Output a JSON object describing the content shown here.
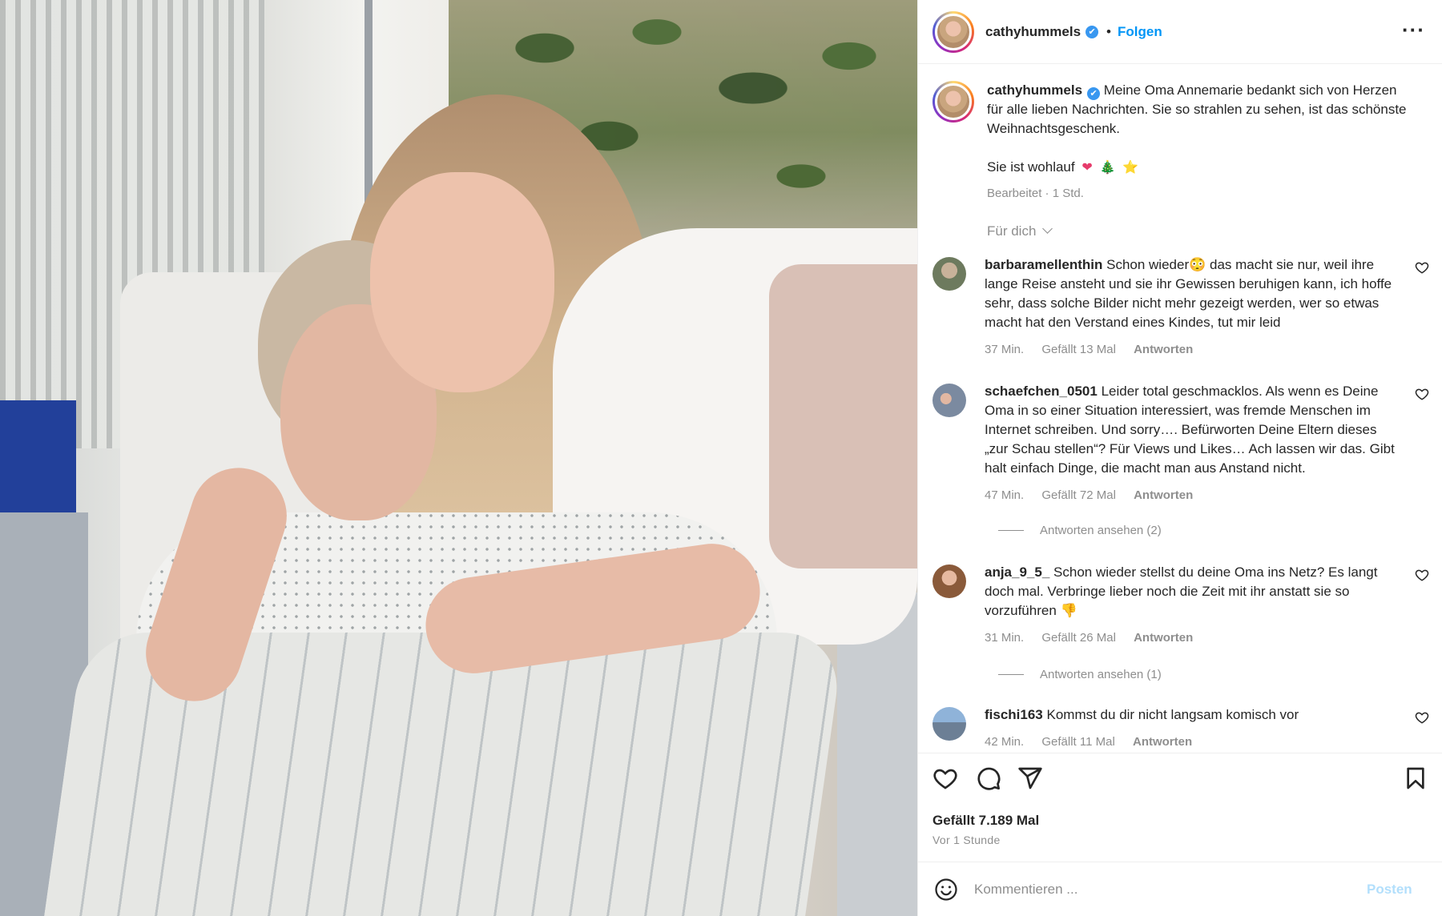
{
  "post": {
    "username": "cathyhummels",
    "verified_glyph": "✔",
    "separator": "•",
    "follow_label": "Folgen",
    "more_label": "···"
  },
  "caption": {
    "username": "cathyhummels",
    "text": "Meine Oma Annemarie bedankt sich von Herzen für alle lieben Nachrichten. Sie so strahlen zu sehen, ist das schönste Weihnachtsgeschenk.",
    "line2": "Sie ist wohlauf",
    "emoji": [
      "❤",
      "🎄",
      "⭐"
    ],
    "meta": "Bearbeitet · 1 Std."
  },
  "filter_label": "Für dich",
  "comments": [
    {
      "username": "barbaramellenthin",
      "text": "Schon wieder😳 das macht sie nur, weil ihre lange Reise ansteht und sie ihr Gewissen beruhigen kann, ich hoffe sehr, dass solche Bilder nicht mehr gezeigt werden, wer so etwas macht hat den Verstand eines Kindes, tut mir leid",
      "time": "37 Min.",
      "likes": "Gefällt 13 Mal",
      "reply": "Antworten"
    },
    {
      "username": "schaefchen_0501",
      "text": "Leider total geschmacklos. Als wenn es Deine Oma in so einer Situation interessiert, was fremde Menschen im Internet schreiben. Und sorry…. Befürworten Deine Eltern dieses „zur Schau stellen“? Für Views und Likes… Ach lassen wir das. Gibt halt einfach Dinge, die macht man aus Anstand nicht.",
      "time": "47 Min.",
      "likes": "Gefällt 72 Mal",
      "reply": "Antworten",
      "view_replies": "Antworten ansehen (2)"
    },
    {
      "username": "anja_9_5_",
      "text": "Schon wieder stellst du deine Oma ins Netz? Es langt doch mal. Verbringe lieber noch die Zeit mit ihr anstatt sie so vorzuführen 👎",
      "time": "31 Min.",
      "likes": "Gefällt 26 Mal",
      "reply": "Antworten",
      "view_replies": "Antworten ansehen (1)"
    },
    {
      "username": "fischi163",
      "text": "Kommst du dir nicht langsam komisch vor",
      "time": "42 Min.",
      "likes": "Gefällt 11 Mal",
      "reply": "Antworten"
    }
  ],
  "actions": {
    "icons": [
      "heart-icon",
      "comment-icon",
      "share-icon",
      "bookmark-icon"
    ],
    "likes_text": "Gefällt 7.189 Mal",
    "time_ago": "Vor 1 Stunde"
  },
  "comment_box": {
    "placeholder": "Kommentieren ...",
    "post_label": "Posten"
  },
  "colors": {
    "accent": "#0095f6",
    "verified": "#3897f0",
    "muted": "#8e8e8e",
    "post_disabled": "#b2dffc"
  }
}
